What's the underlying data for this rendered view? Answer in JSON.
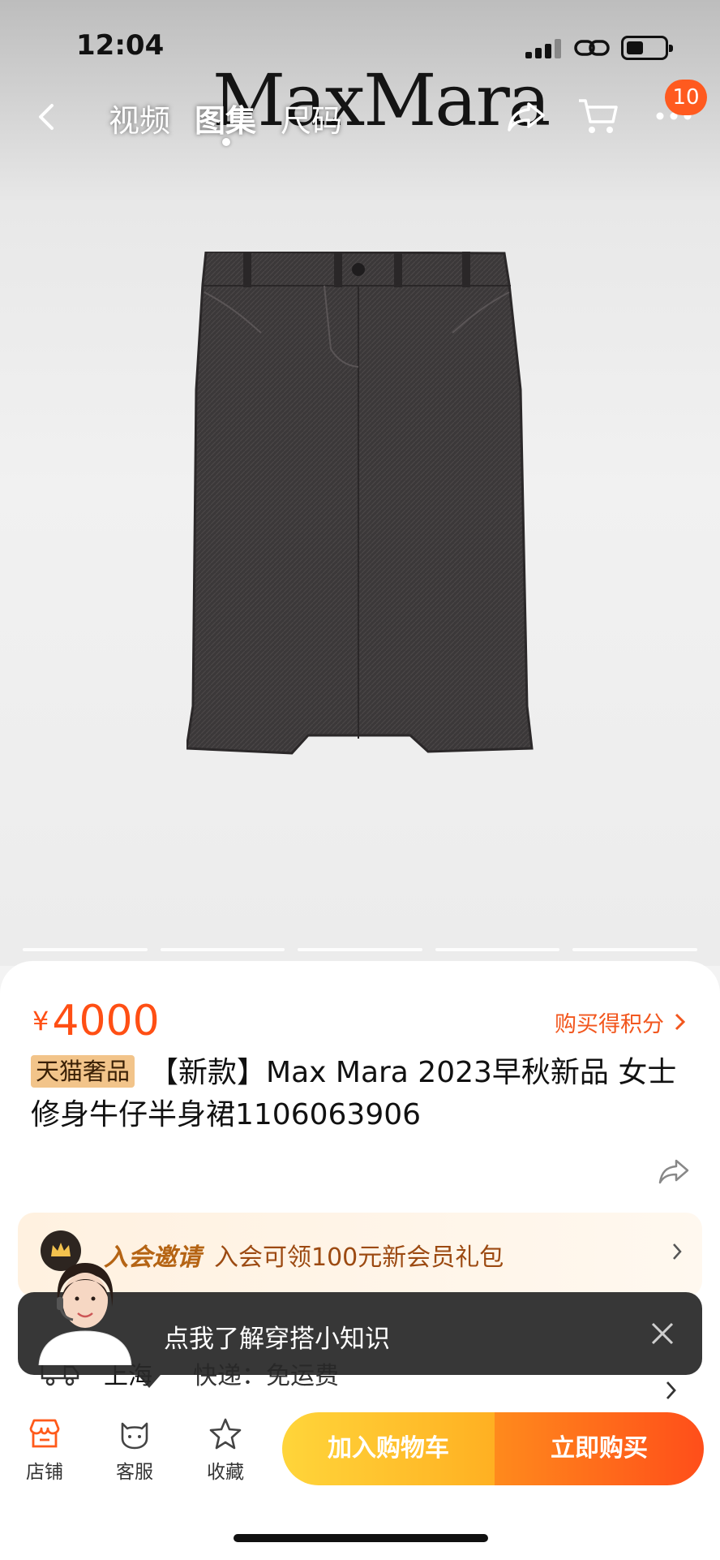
{
  "status_bar": {
    "time": "12:04"
  },
  "hero": {
    "brand_logo_text": "MaxMara",
    "gallery_pages": 5
  },
  "nav": {
    "tabs": [
      {
        "label": "视频"
      },
      {
        "label": "图集"
      },
      {
        "label": "尺码"
      }
    ],
    "active_tab": "图集",
    "cart_badge": "10"
  },
  "product": {
    "currency": "¥",
    "price": "4000",
    "points_link": "购买得积分",
    "tag": "天猫奢品",
    "title": "【新款】Max Mara 2023早秋新品 女士 修身牛仔半身裙1106063906"
  },
  "member": {
    "label": "入会邀请",
    "text": "入会可领100元新会员礼包"
  },
  "shipping": {
    "city": "上海",
    "text": "快递：免运费"
  },
  "tip": {
    "text": "点我了解穿搭小知识"
  },
  "bottom_bar": {
    "store_label": "店铺",
    "service_label": "客服",
    "favorite_label": "收藏",
    "add_to_cart": "加入购物车",
    "buy_now": "立即购买"
  },
  "colors": {
    "accent": "#ff4f14",
    "cart_button": "#ffc22e",
    "buy_button": "#ff5a1a"
  }
}
